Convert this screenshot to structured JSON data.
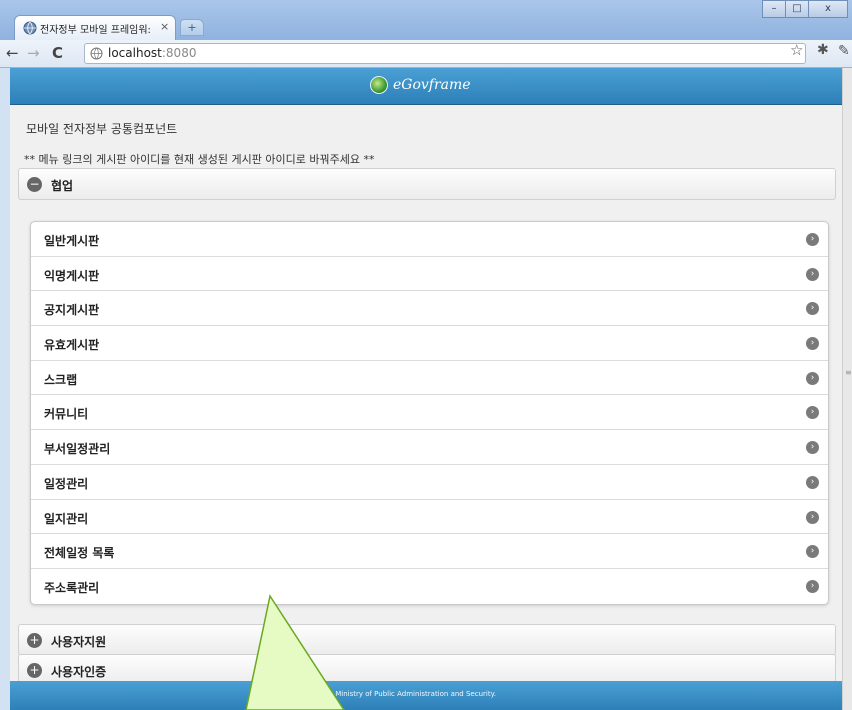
{
  "browser": {
    "tab_title": "전자정부 모바일 프레임워:",
    "tab_close": "×",
    "new_tab": "+",
    "url_host": "localhost",
    "url_port": ":8080",
    "back": "←",
    "forward": "→",
    "reload": "C",
    "star": "☆",
    "ext": "✱",
    "wrench": "✎",
    "minimize": "–",
    "maximize": "□",
    "close": "x"
  },
  "app": {
    "logo_text": "eGovframe",
    "page_title": "모바일 전자정부 공통컴포넌트",
    "notice": "** 메뉴 링크의 게시판 아이디를 현재 생성된 게시판 아이디로 바꿔주세요 **",
    "sections": [
      {
        "label": "협업",
        "icon": "−",
        "expanded": true
      },
      {
        "label": "사용자지원",
        "icon": "+",
        "expanded": false
      },
      {
        "label": "사용자인증",
        "icon": "+",
        "expanded": false
      }
    ],
    "menu_items": [
      "일반게시판",
      "익명게시판",
      "공지게시판",
      "유효게시판",
      "스크랩",
      "커뮤니티",
      "부서일정관리",
      "일정관리",
      "일지관리",
      "전체일정 목록",
      "주소록관리"
    ],
    "arrow_icon": "›",
    "footer": "right (c) Ministry of Public Administration and Security."
  },
  "colors": {
    "header_blue": "#2d80b8",
    "callout_fill": "#e6fbc4",
    "callout_stroke": "#6aa820"
  }
}
